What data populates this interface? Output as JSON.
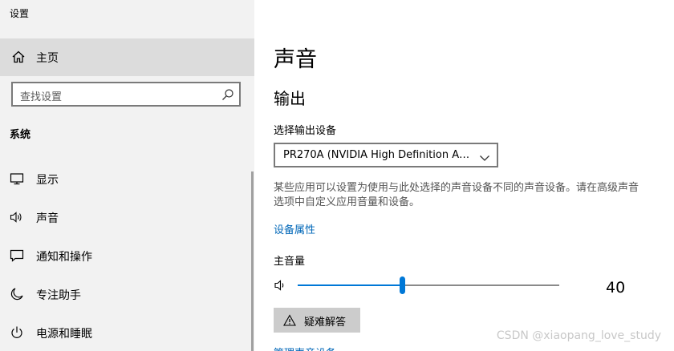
{
  "window": {
    "title": "设置"
  },
  "sidebar": {
    "home_label": "主页",
    "search_placeholder": "查找设置",
    "section_title": "系统",
    "items": [
      {
        "label": "显示",
        "icon": "monitor-icon"
      },
      {
        "label": "声音",
        "icon": "speaker-icon",
        "selected": true
      },
      {
        "label": "通知和操作",
        "icon": "notification-icon"
      },
      {
        "label": "专注助手",
        "icon": "moon-icon"
      },
      {
        "label": "电源和睡眠",
        "icon": "power-icon"
      }
    ]
  },
  "main": {
    "title": "声音",
    "output_heading": "输出",
    "device_label": "选择输出设备",
    "device_value": "PR270A (NVIDIA High Definition Au...",
    "description": "某些应用可以设置为使用与此处选择的声音设备不同的声音设备。请在高级声音选项中自定义应用音量和设备。",
    "device_properties_link": "设备属性",
    "volume_label": "主音量",
    "volume_value": "40",
    "troubleshoot_label": "疑难解答",
    "manage_devices_link": "管理声音设备"
  },
  "colors": {
    "accent": "#0078d7",
    "link": "#0067b8",
    "sidebar_bg": "#f2f2f2",
    "home_selected_bg": "#dcdcdc",
    "button_bg": "#cccccc"
  },
  "watermark": "CSDN @xiaopang_love_study"
}
